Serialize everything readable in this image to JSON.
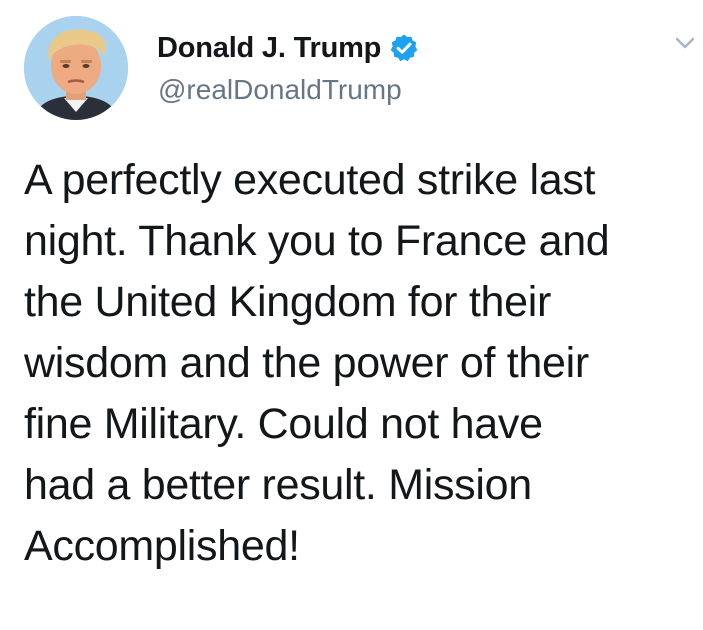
{
  "tweet": {
    "author": {
      "display_name": "Donald J. Trump",
      "handle": "@realDonaldTrump",
      "verified": true,
      "avatar_icon": "profile-photo"
    },
    "text": "A perfectly executed strike last\nnight. Thank you to France and\nthe United Kingdom for their\nwisdom and the power of their\nfine Military. Could not have\nhad a better result. Mission\nAccomplished!",
    "menu_icon": "chevron-down-icon"
  },
  "colors": {
    "text": "#14171a",
    "secondary": "#657786",
    "verified_badge": "#1da1f2",
    "chevron": "#aab8c2",
    "background": "#ffffff"
  }
}
